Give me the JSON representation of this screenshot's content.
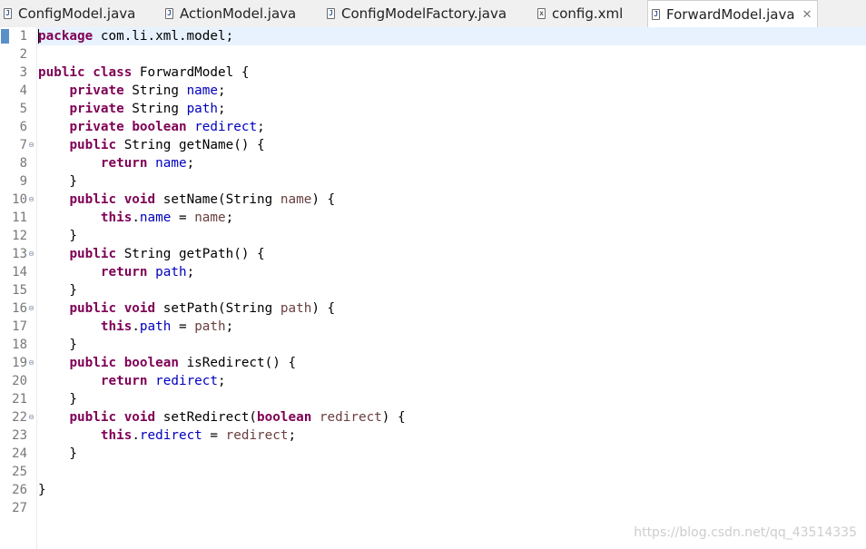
{
  "tabs": [
    {
      "label": "ConfigModel.java",
      "icon": "java-file-icon",
      "active": false
    },
    {
      "label": "ActionModel.java",
      "icon": "java-file-icon",
      "active": false
    },
    {
      "label": "ConfigModelFactory.java",
      "icon": "java-file-icon",
      "active": false
    },
    {
      "label": "config.xml",
      "icon": "xml-file-icon",
      "active": false
    },
    {
      "label": "ForwardModel.java",
      "icon": "java-file-icon",
      "active": true,
      "close_glyph": "✕"
    }
  ],
  "editor": {
    "current_line": 1,
    "fold_glyph": "⊖",
    "lines": [
      {
        "num": "1",
        "tokens": [
          [
            "kw",
            "package"
          ],
          [
            "plain",
            " com.li.xml.model;"
          ]
        ]
      },
      {
        "num": "2",
        "tokens": []
      },
      {
        "num": "3",
        "tokens": [
          [
            "kw",
            "public"
          ],
          [
            "plain",
            " "
          ],
          [
            "kw",
            "class"
          ],
          [
            "plain",
            " ForwardModel {"
          ]
        ]
      },
      {
        "num": "4",
        "tokens": [
          [
            "plain",
            "    "
          ],
          [
            "kw",
            "private"
          ],
          [
            "plain",
            " String "
          ],
          [
            "fld",
            "name"
          ],
          [
            "plain",
            ";"
          ]
        ]
      },
      {
        "num": "5",
        "tokens": [
          [
            "plain",
            "    "
          ],
          [
            "kw",
            "private"
          ],
          [
            "plain",
            " String "
          ],
          [
            "fld",
            "path"
          ],
          [
            "plain",
            ";"
          ]
        ]
      },
      {
        "num": "6",
        "tokens": [
          [
            "plain",
            "    "
          ],
          [
            "kw",
            "private"
          ],
          [
            "plain",
            " "
          ],
          [
            "kw",
            "boolean"
          ],
          [
            "plain",
            " "
          ],
          [
            "fld",
            "redirect"
          ],
          [
            "plain",
            ";"
          ]
        ]
      },
      {
        "num": "7",
        "fold": true,
        "tokens": [
          [
            "plain",
            "    "
          ],
          [
            "kw",
            "public"
          ],
          [
            "plain",
            " String getName() {"
          ]
        ]
      },
      {
        "num": "8",
        "tokens": [
          [
            "plain",
            "        "
          ],
          [
            "kw",
            "return"
          ],
          [
            "plain",
            " "
          ],
          [
            "fld",
            "name"
          ],
          [
            "plain",
            ";"
          ]
        ]
      },
      {
        "num": "9",
        "tokens": [
          [
            "plain",
            "    }"
          ]
        ]
      },
      {
        "num": "10",
        "fold": true,
        "tokens": [
          [
            "plain",
            "    "
          ],
          [
            "kw",
            "public"
          ],
          [
            "plain",
            " "
          ],
          [
            "kw",
            "void"
          ],
          [
            "plain",
            " setName(String "
          ],
          [
            "prm",
            "name"
          ],
          [
            "plain",
            ") {"
          ]
        ]
      },
      {
        "num": "11",
        "tokens": [
          [
            "plain",
            "        "
          ],
          [
            "kw",
            "this"
          ],
          [
            "plain",
            "."
          ],
          [
            "fld",
            "name"
          ],
          [
            "plain",
            " = "
          ],
          [
            "prm",
            "name"
          ],
          [
            "plain",
            ";"
          ]
        ]
      },
      {
        "num": "12",
        "tokens": [
          [
            "plain",
            "    }"
          ]
        ]
      },
      {
        "num": "13",
        "fold": true,
        "tokens": [
          [
            "plain",
            "    "
          ],
          [
            "kw",
            "public"
          ],
          [
            "plain",
            " String getPath() {"
          ]
        ]
      },
      {
        "num": "14",
        "tokens": [
          [
            "plain",
            "        "
          ],
          [
            "kw",
            "return"
          ],
          [
            "plain",
            " "
          ],
          [
            "fld",
            "path"
          ],
          [
            "plain",
            ";"
          ]
        ]
      },
      {
        "num": "15",
        "tokens": [
          [
            "plain",
            "    }"
          ]
        ]
      },
      {
        "num": "16",
        "fold": true,
        "tokens": [
          [
            "plain",
            "    "
          ],
          [
            "kw",
            "public"
          ],
          [
            "plain",
            " "
          ],
          [
            "kw",
            "void"
          ],
          [
            "plain",
            " setPath(String "
          ],
          [
            "prm",
            "path"
          ],
          [
            "plain",
            ") {"
          ]
        ]
      },
      {
        "num": "17",
        "tokens": [
          [
            "plain",
            "        "
          ],
          [
            "kw",
            "this"
          ],
          [
            "plain",
            "."
          ],
          [
            "fld",
            "path"
          ],
          [
            "plain",
            " = "
          ],
          [
            "prm",
            "path"
          ],
          [
            "plain",
            ";"
          ]
        ]
      },
      {
        "num": "18",
        "tokens": [
          [
            "plain",
            "    }"
          ]
        ]
      },
      {
        "num": "19",
        "fold": true,
        "tokens": [
          [
            "plain",
            "    "
          ],
          [
            "kw",
            "public"
          ],
          [
            "plain",
            " "
          ],
          [
            "kw",
            "boolean"
          ],
          [
            "plain",
            " isRedirect() {"
          ]
        ]
      },
      {
        "num": "20",
        "tokens": [
          [
            "plain",
            "        "
          ],
          [
            "kw",
            "return"
          ],
          [
            "plain",
            " "
          ],
          [
            "fld",
            "redirect"
          ],
          [
            "plain",
            ";"
          ]
        ]
      },
      {
        "num": "21",
        "tokens": [
          [
            "plain",
            "    }"
          ]
        ]
      },
      {
        "num": "22",
        "fold": true,
        "tokens": [
          [
            "plain",
            "    "
          ],
          [
            "kw",
            "public"
          ],
          [
            "plain",
            " "
          ],
          [
            "kw",
            "void"
          ],
          [
            "plain",
            " setRedirect("
          ],
          [
            "kw",
            "boolean"
          ],
          [
            "plain",
            " "
          ],
          [
            "prm",
            "redirect"
          ],
          [
            "plain",
            ") {"
          ]
        ]
      },
      {
        "num": "23",
        "tokens": [
          [
            "plain",
            "        "
          ],
          [
            "kw",
            "this"
          ],
          [
            "plain",
            "."
          ],
          [
            "fld",
            "redirect"
          ],
          [
            "plain",
            " = "
          ],
          [
            "prm",
            "redirect"
          ],
          [
            "plain",
            ";"
          ]
        ]
      },
      {
        "num": "24",
        "tokens": [
          [
            "plain",
            "    }"
          ]
        ]
      },
      {
        "num": "25",
        "tokens": []
      },
      {
        "num": "26",
        "tokens": [
          [
            "plain",
            "}"
          ]
        ]
      },
      {
        "num": "27",
        "tokens": []
      }
    ]
  },
  "colors": {
    "keyword": "#7f0055",
    "field": "#0000c0",
    "parameter": "#6a3e3e",
    "current_line_bg": "#e8f2fe",
    "line_number": "#787878"
  },
  "watermark": "https://blog.csdn.net/qq_43514335"
}
